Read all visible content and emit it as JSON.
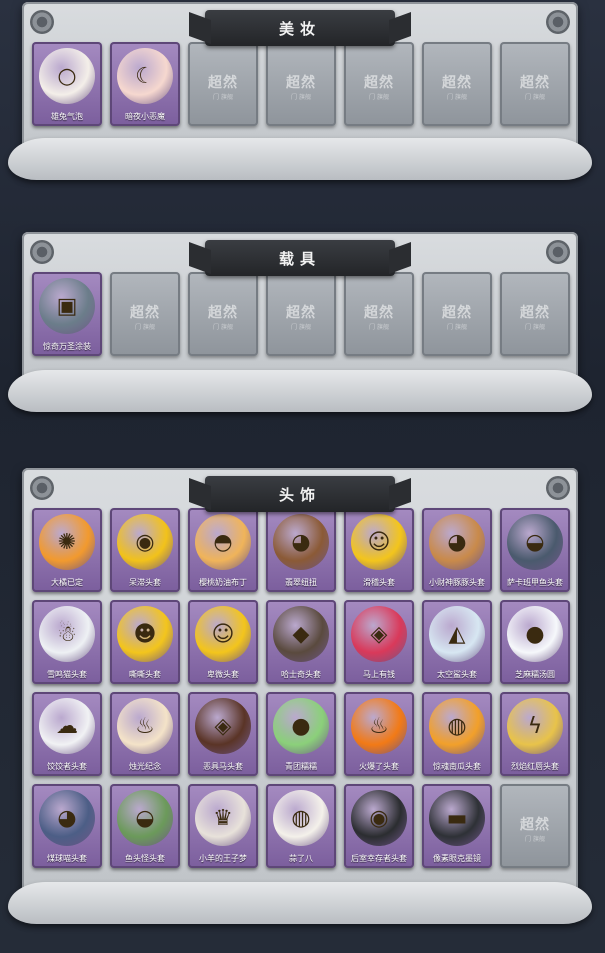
{
  "sections": [
    {
      "title": "美妆",
      "items": [
        {
          "label": "雄兔气泡",
          "locked": false,
          "color": "#f4efe9",
          "icon": "bubble-head-icon"
        },
        {
          "label": "暗夜小恶魔",
          "locked": false,
          "color": "#f6d8cf",
          "icon": "devil-head-icon"
        },
        {
          "label": "超然",
          "locked": true,
          "sub": "门 旗舰"
        },
        {
          "label": "超然",
          "locked": true,
          "sub": "门 旗舰"
        },
        {
          "label": "超然",
          "locked": true,
          "sub": "门 旗舰"
        },
        {
          "label": "超然",
          "locked": true,
          "sub": "门 旗舰"
        },
        {
          "label": "超然",
          "locked": true,
          "sub": "门 旗舰"
        }
      ]
    },
    {
      "title": "载具",
      "items": [
        {
          "label": "惊奇万圣涂装",
          "locked": false,
          "color": "#6b7d8a",
          "icon": "truck-icon"
        },
        {
          "label": "超然",
          "locked": true,
          "sub": "门 旗舰"
        },
        {
          "label": "超然",
          "locked": true,
          "sub": "门 旗舰"
        },
        {
          "label": "超然",
          "locked": true,
          "sub": "门 旗舰"
        },
        {
          "label": "超然",
          "locked": true,
          "sub": "门 旗舰"
        },
        {
          "label": "超然",
          "locked": true,
          "sub": "门 旗舰"
        },
        {
          "label": "超然",
          "locked": true,
          "sub": "门 旗舰"
        }
      ]
    },
    {
      "title": "头饰",
      "items": [
        {
          "label": "大橘已定",
          "locked": false,
          "color": "#f29a2e",
          "icon": "orange-head-icon"
        },
        {
          "label": "呆滞头套",
          "locked": false,
          "color": "#f2c21a",
          "icon": "dazed-face-icon"
        },
        {
          "label": "樱桃奶油布丁",
          "locked": false,
          "color": "#f0b45a",
          "icon": "pudding-icon"
        },
        {
          "label": "翡翠纽扭",
          "locked": false,
          "color": "#8b5a36",
          "icon": "dog-head-icon"
        },
        {
          "label": "滑稽头套",
          "locked": false,
          "color": "#f3c51c",
          "icon": "funny-face-icon"
        },
        {
          "label": "小财神豚豚头套",
          "locked": false,
          "color": "#c98a4a",
          "icon": "capybara-head-icon"
        },
        {
          "label": "萨卡班甲鱼头套",
          "locked": false,
          "color": "#4a5a6d",
          "icon": "fish-head-icon"
        },
        {
          "label": "雪鸣猫头套",
          "locked": false,
          "color": "#eef1f4",
          "icon": "snowman-head-icon"
        },
        {
          "label": "嘶嘶头套",
          "locked": false,
          "color": "#f3c51c",
          "icon": "grin-face-icon"
        },
        {
          "label": "卑微头套",
          "locked": false,
          "color": "#f3c51c",
          "icon": "humble-face-icon"
        },
        {
          "label": "哈士奇头套",
          "locked": false,
          "color": "#5a4a3e",
          "icon": "husky-head-icon"
        },
        {
          "label": "马上有钱",
          "locked": false,
          "color": "#d9395a",
          "icon": "horse-head-icon"
        },
        {
          "label": "太空鲨头套",
          "locked": false,
          "color": "#d7e7f2",
          "icon": "shark-head-icon"
        },
        {
          "label": "芝麻糯汤圆",
          "locked": false,
          "color": "#f6f8fb",
          "icon": "dumpling-head-icon"
        },
        {
          "label": "饺饺者头套",
          "locked": false,
          "color": "#f1f2f4",
          "icon": "cloud-head-icon"
        },
        {
          "label": "烛光纪念",
          "locked": false,
          "color": "#f4e3c8",
          "icon": "candle-head-icon"
        },
        {
          "label": "恶具马头套",
          "locked": false,
          "color": "#5a3426",
          "icon": "brown-horse-icon"
        },
        {
          "label": "青团糯糯",
          "locked": false,
          "color": "#8bd07a",
          "icon": "green-bun-icon"
        },
        {
          "label": "火爆了头套",
          "locked": false,
          "color": "#f27a16",
          "icon": "fire-head-icon"
        },
        {
          "label": "惊魂南瓜头套",
          "locked": false,
          "color": "#f2a02a",
          "icon": "pumpkin-head-icon"
        },
        {
          "label": "烈焰红唇头套",
          "locked": false,
          "color": "#e8c34a",
          "icon": "pikachu-head-icon"
        },
        {
          "label": "煤球喵头套",
          "locked": false,
          "color": "#4c5e86",
          "icon": "cat-head-icon"
        },
        {
          "label": "鱼头怪头套",
          "locked": false,
          "color": "#6b9a5a",
          "icon": "fishman-head-icon"
        },
        {
          "label": "小羊的王子梦",
          "locked": false,
          "color": "#e8e2da",
          "icon": "sheep-head-icon"
        },
        {
          "label": "蒜了八",
          "locked": false,
          "color": "#f4f1ea",
          "icon": "garlic-head-icon"
        },
        {
          "label": "后室幸存者头套",
          "locked": false,
          "color": "#2b2d30",
          "icon": "gasmask-head-icon"
        },
        {
          "label": "像素眼克墨镜",
          "locked": false,
          "color": "#2e3136",
          "icon": "pixel-glasses-icon"
        },
        {
          "label": "超然",
          "locked": true,
          "sub": "门 旗舰"
        }
      ]
    }
  ]
}
